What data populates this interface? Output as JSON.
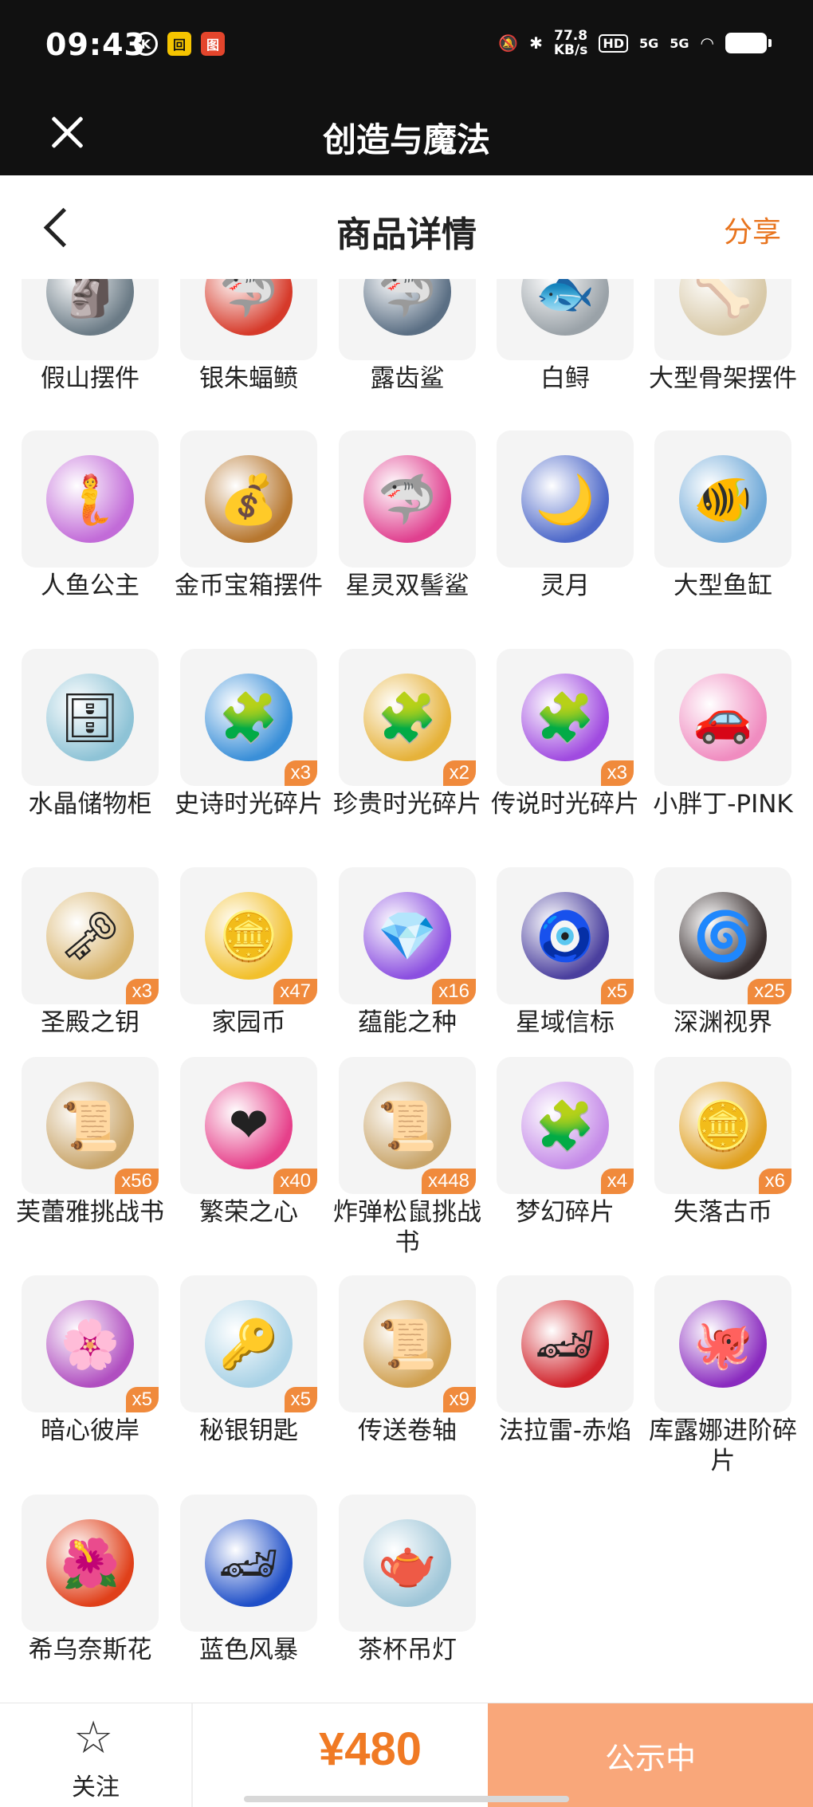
{
  "status_bar": {
    "time": "09:43",
    "left_icons": [
      "K",
      "回",
      "图"
    ],
    "net_speed": "77.8",
    "net_unit": "KB/s",
    "hd": "HD",
    "sig1": "5G",
    "sig2": "5G"
  },
  "app_bar": {
    "title": "创造与魔法"
  },
  "header": {
    "title": "商品详情",
    "share": "分享"
  },
  "items": [
    {
      "name": "假山摆件",
      "badge": "",
      "color": "#6b7b86",
      "icon": "🗿"
    },
    {
      "name": "银朱蝠鲼",
      "badge": "",
      "color": "#d63a2a",
      "icon": "🦈"
    },
    {
      "name": "露齿鲨",
      "badge": "",
      "color": "#5b6f84",
      "icon": "🦈"
    },
    {
      "name": "白鲟",
      "badge": "",
      "color": "#9aa2a8",
      "icon": "🐟"
    },
    {
      "name": "大型骨架摆件",
      "badge": "",
      "color": "#d8c9a8",
      "icon": "🦴"
    },
    {
      "name": "人鱼公主",
      "badge": "",
      "color": "#c26bd8",
      "icon": "🧜"
    },
    {
      "name": "金币宝箱摆件",
      "badge": "",
      "color": "#b7772f",
      "icon": "💰"
    },
    {
      "name": "星灵双髻鲨",
      "badge": "",
      "color": "#e0408f",
      "icon": "🦈"
    },
    {
      "name": "灵月",
      "badge": "",
      "color": "#4d68c9",
      "icon": "🌙"
    },
    {
      "name": "大型鱼缸",
      "badge": "",
      "color": "#6fa9d8",
      "icon": "🐠"
    },
    {
      "name": "水晶储物柜",
      "badge": "",
      "color": "#8ec3d6",
      "icon": "🗄"
    },
    {
      "name": "史诗时光碎片",
      "badge": "x3",
      "color": "#3a8fd8",
      "icon": "🧩"
    },
    {
      "name": "珍贵时光碎片",
      "badge": "x2",
      "color": "#e6b23a",
      "icon": "🧩"
    },
    {
      "name": "传说时光碎片",
      "badge": "x3",
      "color": "#a04be0",
      "icon": "🧩"
    },
    {
      "name": "小胖丁-PINK",
      "badge": "",
      "color": "#f08cc0",
      "icon": "🚗"
    },
    {
      "name": "圣殿之钥",
      "badge": "x3",
      "color": "#d8b36a",
      "icon": "🗝"
    },
    {
      "name": "家园币",
      "badge": "x47",
      "color": "#f2c02c",
      "icon": "🪙"
    },
    {
      "name": "蕴能之种",
      "badge": "x16",
      "color": "#8b4fe0",
      "icon": "💎"
    },
    {
      "name": "星域信标",
      "badge": "x5",
      "color": "#4a3f9e",
      "icon": "🧿"
    },
    {
      "name": "深渊视界",
      "badge": "x25",
      "color": "#3a3030",
      "icon": "🌀"
    },
    {
      "name": "芙蕾雅挑战书",
      "badge": "x56",
      "color": "#c9a56a",
      "icon": "📜"
    },
    {
      "name": "繁荣之心",
      "badge": "x40",
      "color": "#e6408a",
      "icon": "❤"
    },
    {
      "name": "炸弹松鼠挑战书",
      "badge": "x448",
      "color": "#c9a56a",
      "icon": "📜"
    },
    {
      "name": "梦幻碎片",
      "badge": "x4",
      "color": "#c58be8",
      "icon": "🧩"
    },
    {
      "name": "失落古币",
      "badge": "x6",
      "color": "#e0a020",
      "icon": "🪙"
    },
    {
      "name": "暗心彼岸",
      "badge": "x5",
      "color": "#b04ec0",
      "icon": "🌸"
    },
    {
      "name": "秘银钥匙",
      "badge": "x5",
      "color": "#a9d2e6",
      "icon": "🔑"
    },
    {
      "name": "传送卷轴",
      "badge": "x9",
      "color": "#d0a050",
      "icon": "📜"
    },
    {
      "name": "法拉雷-赤焰",
      "badge": "",
      "color": "#d0222a",
      "icon": "🏎"
    },
    {
      "name": "库露娜进阶碎片",
      "badge": "",
      "color": "#8a2bbf",
      "icon": "🐙"
    },
    {
      "name": "希乌奈斯花",
      "badge": "",
      "color": "#e0401a",
      "icon": "🌺"
    },
    {
      "name": "蓝色风暴",
      "badge": "",
      "color": "#1f4fc8",
      "icon": "🏎"
    },
    {
      "name": "茶杯吊灯",
      "badge": "",
      "color": "#9fc6d8",
      "icon": "🫖"
    }
  ],
  "bottom": {
    "follow_label": "关注",
    "price": "¥480",
    "status_button": "公示中"
  }
}
